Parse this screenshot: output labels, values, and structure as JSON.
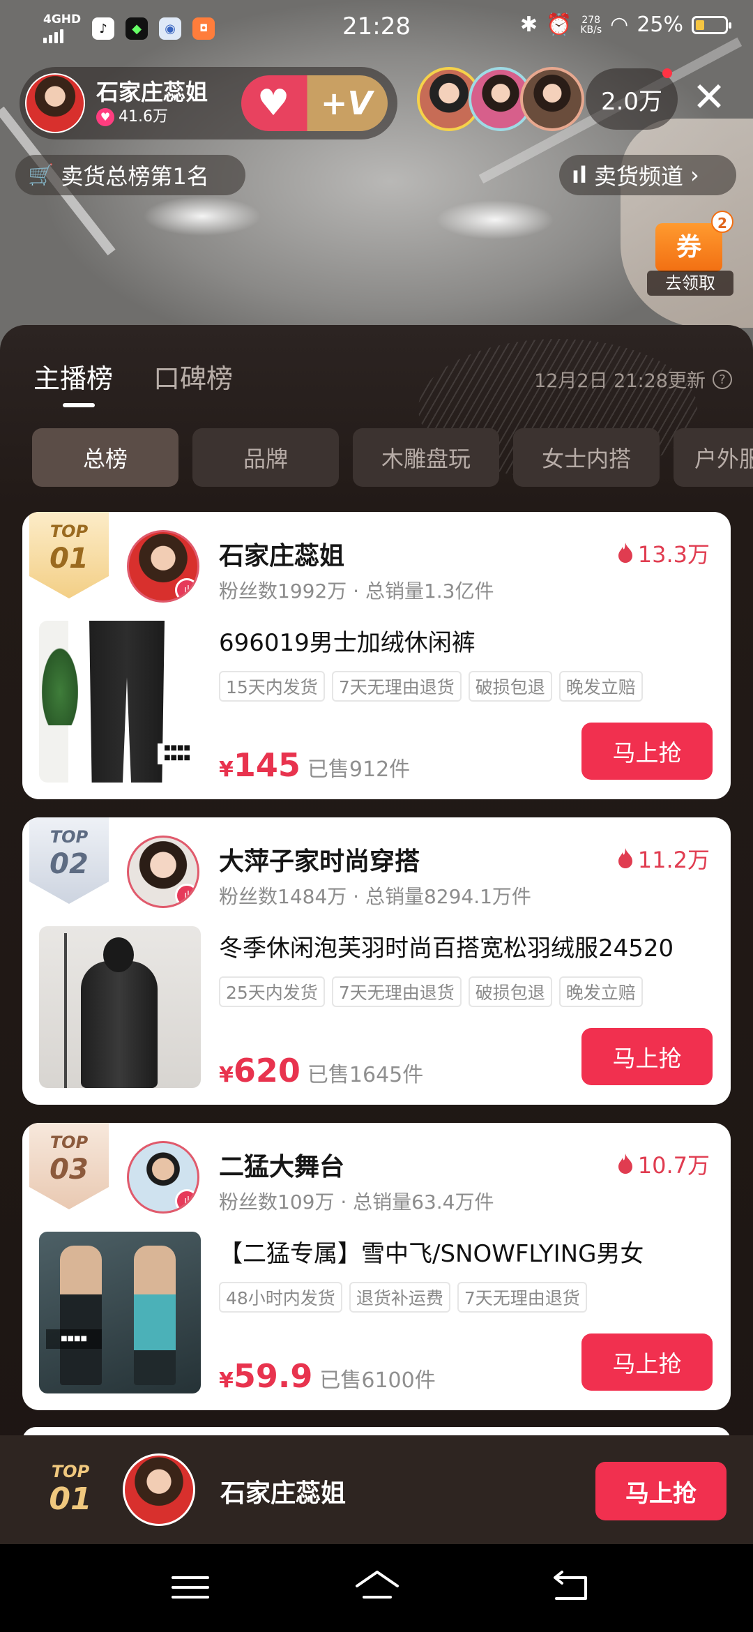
{
  "status_bar": {
    "network": "4GHD",
    "time": "21:28",
    "speed_value": "278",
    "speed_unit": "KB/s",
    "battery": "25%"
  },
  "host": {
    "name": "石家庄蕊姐",
    "likes": "41.6万",
    "follow_label": "+V"
  },
  "viewers": {
    "count": "2.0万"
  },
  "chips": {
    "sales_rank": "卖货总榜第1名",
    "sales_channel": "卖货频道"
  },
  "coupon": {
    "label": "券",
    "count": "2",
    "action": "去领取"
  },
  "panel": {
    "tabs": [
      {
        "label": "主播榜",
        "active": true
      },
      {
        "label": "口碑榜",
        "active": false
      }
    ],
    "update_time": "12月2日 21:28更新",
    "categories": [
      {
        "label": "总榜",
        "active": true
      },
      {
        "label": "品牌",
        "active": false
      },
      {
        "label": "木雕盘玩",
        "active": false
      },
      {
        "label": "女士内搭",
        "active": false
      },
      {
        "label": "户外服",
        "active": false
      }
    ]
  },
  "cards": [
    {
      "rank_top": "TOP",
      "rank_num": "01",
      "name": "石家庄蕊姐",
      "stats": "粉丝数1992万 · 总销量1.3亿件",
      "hot": "13.3万",
      "product_title": "696019男士加绒休闲裤",
      "tags": [
        "15天内发货",
        "7天无理由退货",
        "破损包退",
        "晚发立赔"
      ],
      "price_symbol": "¥",
      "price": "145",
      "sold": "已售912件",
      "buy_label": "马上抢"
    },
    {
      "rank_top": "TOP",
      "rank_num": "02",
      "name": "大萍子家时尚穿搭",
      "stats": "粉丝数1484万 · 总销量8294.1万件",
      "hot": "11.2万",
      "product_title": "冬季休闲泡芙羽时尚百搭宽松羽绒服24520",
      "tags": [
        "25天内发货",
        "7天无理由退货",
        "破损包退",
        "晚发立赔"
      ],
      "price_symbol": "¥",
      "price": "620",
      "sold": "已售1645件",
      "buy_label": "马上抢"
    },
    {
      "rank_top": "TOP",
      "rank_num": "03",
      "name": "二猛大舞台",
      "stats": "粉丝数109万 · 总销量63.4万件",
      "hot": "10.7万",
      "product_title": "【二猛专属】雪中飞/SNOWFLYING男女",
      "tags": [
        "48小时内发货",
        "退货补运费",
        "7天无理由退货"
      ],
      "price_symbol": "¥",
      "price": "59.9",
      "sold": "已售6100件",
      "buy_label": "马上抢"
    }
  ],
  "sticky": {
    "rank_top": "TOP",
    "rank_num": "01",
    "name": "石家庄蕊姐",
    "buy_label": "马上抢"
  },
  "colors": {
    "accent": "#f1304f",
    "gold": "#f0c87e",
    "silver": "#dfe4ee",
    "bronze": "#f1dccd"
  }
}
